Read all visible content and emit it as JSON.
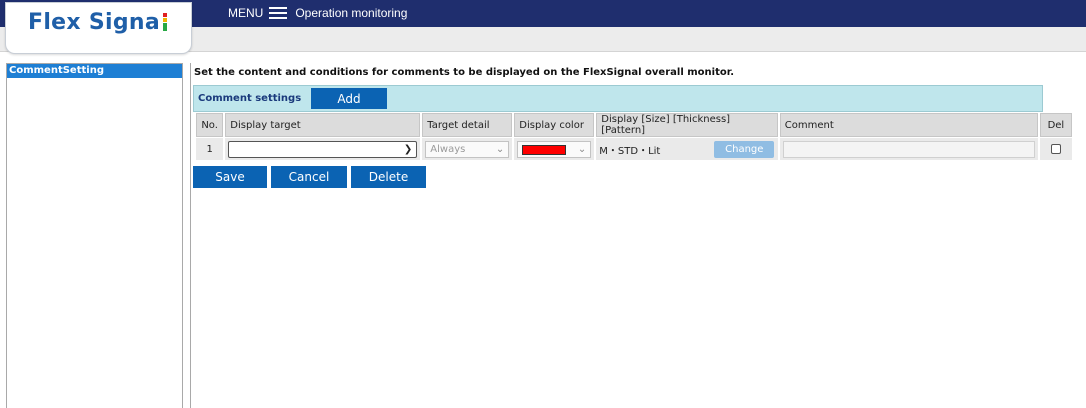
{
  "app": {
    "logo_text": "Flex Sign",
    "logo_last": "a",
    "logo_tail": "l",
    "menu_label": "MENU",
    "page_title": "Operation monitoring"
  },
  "sidebar": {
    "items": [
      {
        "label": "CommentSetting"
      }
    ]
  },
  "main": {
    "description": "Set the content and conditions for comments to be displayed on the FlexSignal overall monitor.",
    "settings_label": "Comment settings",
    "add_label": "Add",
    "columns": [
      {
        "label": "No."
      },
      {
        "label": "Display target"
      },
      {
        "label": "Target detail"
      },
      {
        "label": "Display color"
      },
      {
        "label": "Display [Size] [Thickness] [Pattern]"
      },
      {
        "label": "Comment"
      },
      {
        "label": "Del"
      }
    ],
    "rows": [
      {
        "no": "1",
        "display_target": "",
        "target_detail": "Always",
        "display_color": "#ff0000",
        "display_style": "M・STD・Lit",
        "change_label": "Change",
        "comment": ""
      }
    ],
    "actions": {
      "save_label": "Save",
      "cancel_label": "Cancel",
      "delete_label": "Delete"
    }
  },
  "colors": {
    "topbar": "#1f2e6e",
    "accent": "#0b63b3",
    "sidebar_selected": "#1e7fd4",
    "settings_bar": "#bfe6ec"
  }
}
